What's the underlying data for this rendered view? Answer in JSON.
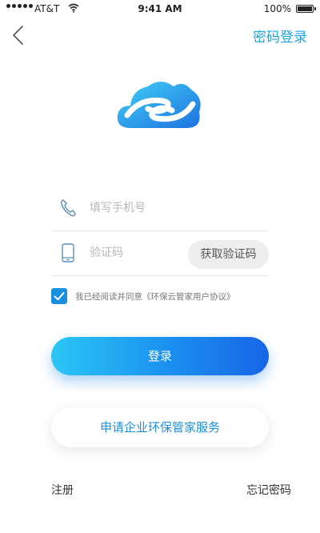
{
  "status_bar": {
    "carrier": "AT&T",
    "time": "9:41 AM",
    "battery": "100%",
    "signal_bars_filled": 5,
    "battery_level_percent": 100
  },
  "nav": {
    "back_icon": "chevron-left-icon",
    "password_login_label": "密码登录"
  },
  "logo": {
    "icon": "cloud-hands-logo",
    "colors": {
      "light": "#35c3f3",
      "dark": "#1f72e0"
    }
  },
  "form": {
    "phone": {
      "icon": "phone-icon",
      "placeholder": "填写手机号",
      "value": ""
    },
    "code": {
      "icon": "mobile-device-icon",
      "placeholder": "验证码",
      "value": ""
    },
    "get_code_label": "获取验证码"
  },
  "agreement": {
    "checked": true,
    "text": "我已经阅读并同意《环保云管家用户协议》"
  },
  "buttons": {
    "login_label": "登录",
    "apply_label": "申请企业环保管家服务"
  },
  "footer": {
    "register_label": "注册",
    "forgot_label": "忘记密码"
  },
  "colors": {
    "accent": "#1fa5d8",
    "checkbox": "#1a8fe0",
    "button_gradient_start": "#2bc7f5",
    "button_gradient_end": "#1766e6"
  }
}
